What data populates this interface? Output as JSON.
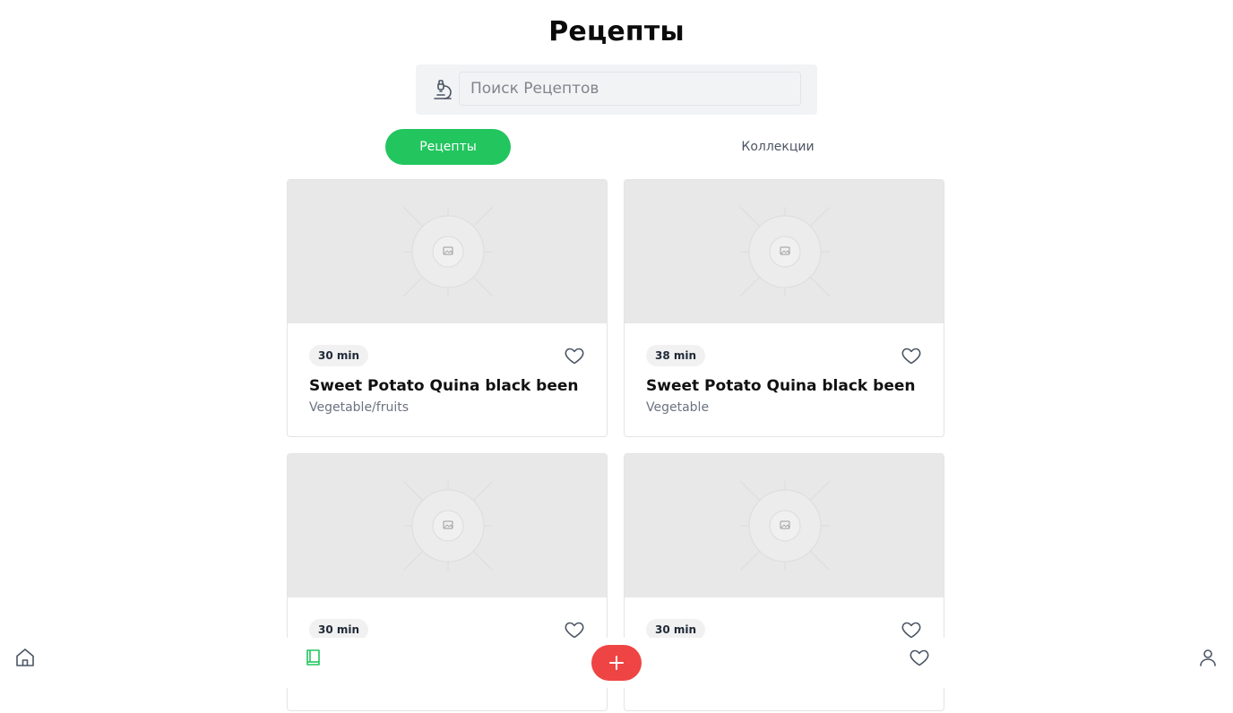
{
  "header": {
    "title": "Рецепты"
  },
  "search": {
    "placeholder": "Поиск Рецептов"
  },
  "tabs": [
    {
      "label": "Рецепты",
      "active": true
    },
    {
      "label": "Коллекции",
      "active": false
    }
  ],
  "recipes": [
    {
      "time": "30 min",
      "title": "Sweet Potato Quina black been",
      "category": "Vegetable/fruits"
    },
    {
      "time": "38 min",
      "title": "Sweet Potato Quina black been",
      "category": "Vegetable"
    },
    {
      "time": "30 min"
    },
    {
      "time": "30 min"
    }
  ],
  "bottom_nav": {
    "items": [
      "home-icon",
      "book-icon",
      "plus-icon",
      "heart-icon",
      "user-icon"
    ]
  },
  "colors": {
    "accent": "#22c55e",
    "fab": "#ef4444"
  }
}
